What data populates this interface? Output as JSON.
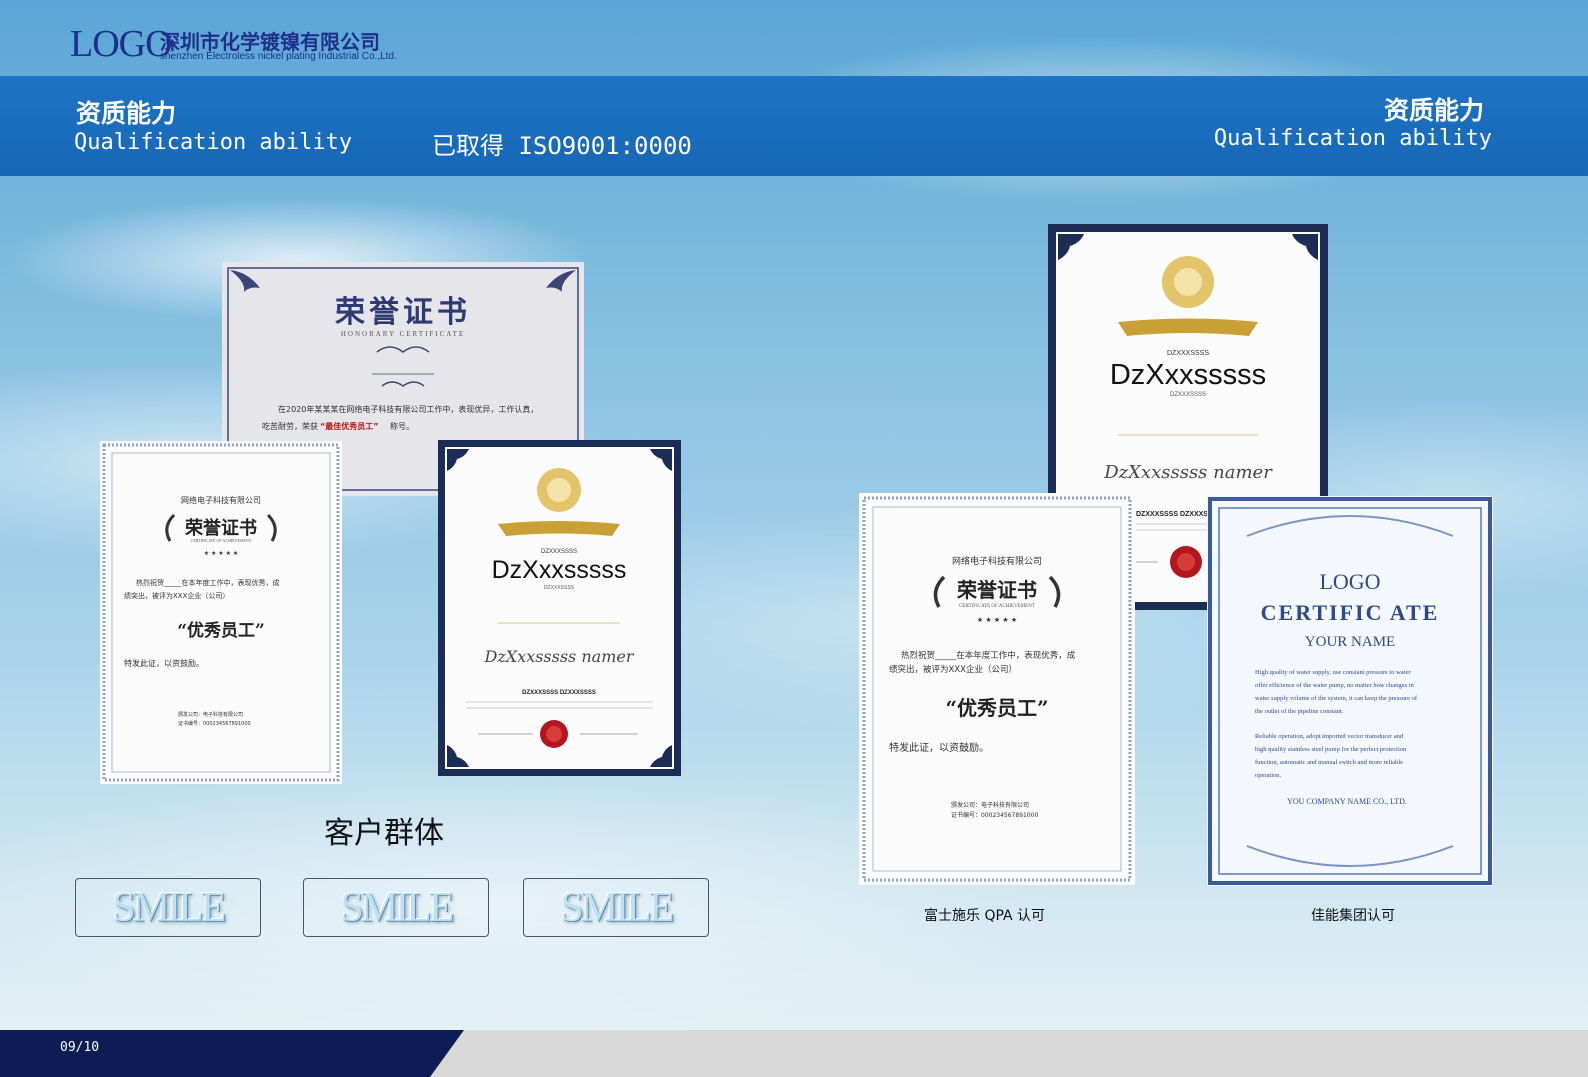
{
  "header": {
    "logo_word": "LOGO",
    "company_cn": "深圳市化学镀镍有限公司",
    "company_en": "shenzhen Electroless nickel plating Industrial Co.,Ltd."
  },
  "band": {
    "left_title_cn": "资质能力",
    "left_title_en": "Qualification ability",
    "iso_text": "已取得 ISO9001:0000",
    "right_title_cn": "资质能力",
    "right_title_en": "Qualification ability"
  },
  "certificates": {
    "honorary": {
      "title": "荣誉证书",
      "subtitle": "HONORARY CERTIFICATE",
      "line1": "在2020年某某某在网络电子科技有限公司工作中，表现优异，工作认真，",
      "line2": "吃苦耐劳，荣获",
      "highlight": "“最佳优秀员工”",
      "line2_end": "称号。"
    },
    "employee_small": {
      "company": "网络电子科技有限公司",
      "title": "荣誉证书",
      "subtitle": "CERTIFICATE OF ACHIEVEMENT",
      "stars": "★ ★ ★ ★ ★",
      "body1": "热烈祝贺_____在本年度工作中，表现优秀，成",
      "body2": "绩突出，被评为XXX企业（公司）",
      "award": "“优秀员工”",
      "closing": "特发此证，以资鼓励。",
      "issuer": "颁发公司：电子科技有限公司",
      "number": "证书编号：000234567891000"
    },
    "gold_small": {
      "small_code": "DZXXXSSSS",
      "name": "DzXxxsssss",
      "sub_code": "DZXXXSSSS",
      "script": "DzXxxsssss namer",
      "bottom_code": "DZXXXSSSS DZXXXSSSS"
    },
    "gold_large": {
      "small_code": "DZXXXSSSS",
      "name": "DzXxxsssss",
      "sub_code": "DZXXXSSSS",
      "script": "DzXxxsssss namer",
      "bottom_code": "DZXXXSSSS DZXXXSSSS"
    },
    "employee_large": {
      "company": "网络电子科技有限公司",
      "title": "荣誉证书",
      "subtitle": "CERTIFICATE OF ACHIEVEMENT",
      "stars": "★ ★ ★ ★ ★",
      "body1": "热烈祝贺_____在本年度工作中，表现优秀，成",
      "body2": "绩突出，被评为XXX企业（公司）",
      "award": "“优秀员工”",
      "closing": "特发此证，以资鼓励。",
      "issuer": "颁发公司：电子科技有限公司",
      "number": "证书编号：000234567891000"
    },
    "logo_cert": {
      "logo": "LOGO",
      "title": "CERTIFIC ATE",
      "your_name": "YOUR NAME",
      "p1a": "High quality of water supply, use constant pressure to water",
      "p1b": "offer efficience of the water pump, no matter how changes in",
      "p1c": "water supply volume of the system, it can keep the pressure of",
      "p1d": "the outlet of the pipeline constant.",
      "p2a": "Reliable operation, adopt imported vector transducer and",
      "p2b": "high quality stainless steel pump for the perfect protection",
      "p2c": "function, automatic and manual switch and more reliable",
      "p2d": "operation.",
      "company": "YOU COMPANY NAME CO., LTD."
    }
  },
  "section_title": "客户群体",
  "client_logos": [
    "SMILE",
    "SMILE",
    "SMILE"
  ],
  "captions": {
    "left": "富士施乐 QPA 认可",
    "right": "佳能集团认可"
  },
  "footer": {
    "page": "09/10"
  },
  "colors": {
    "band": "#1667b6",
    "navy": "#0d1c55",
    "logo": "#1f2f8c",
    "gold": "#c9a035"
  }
}
